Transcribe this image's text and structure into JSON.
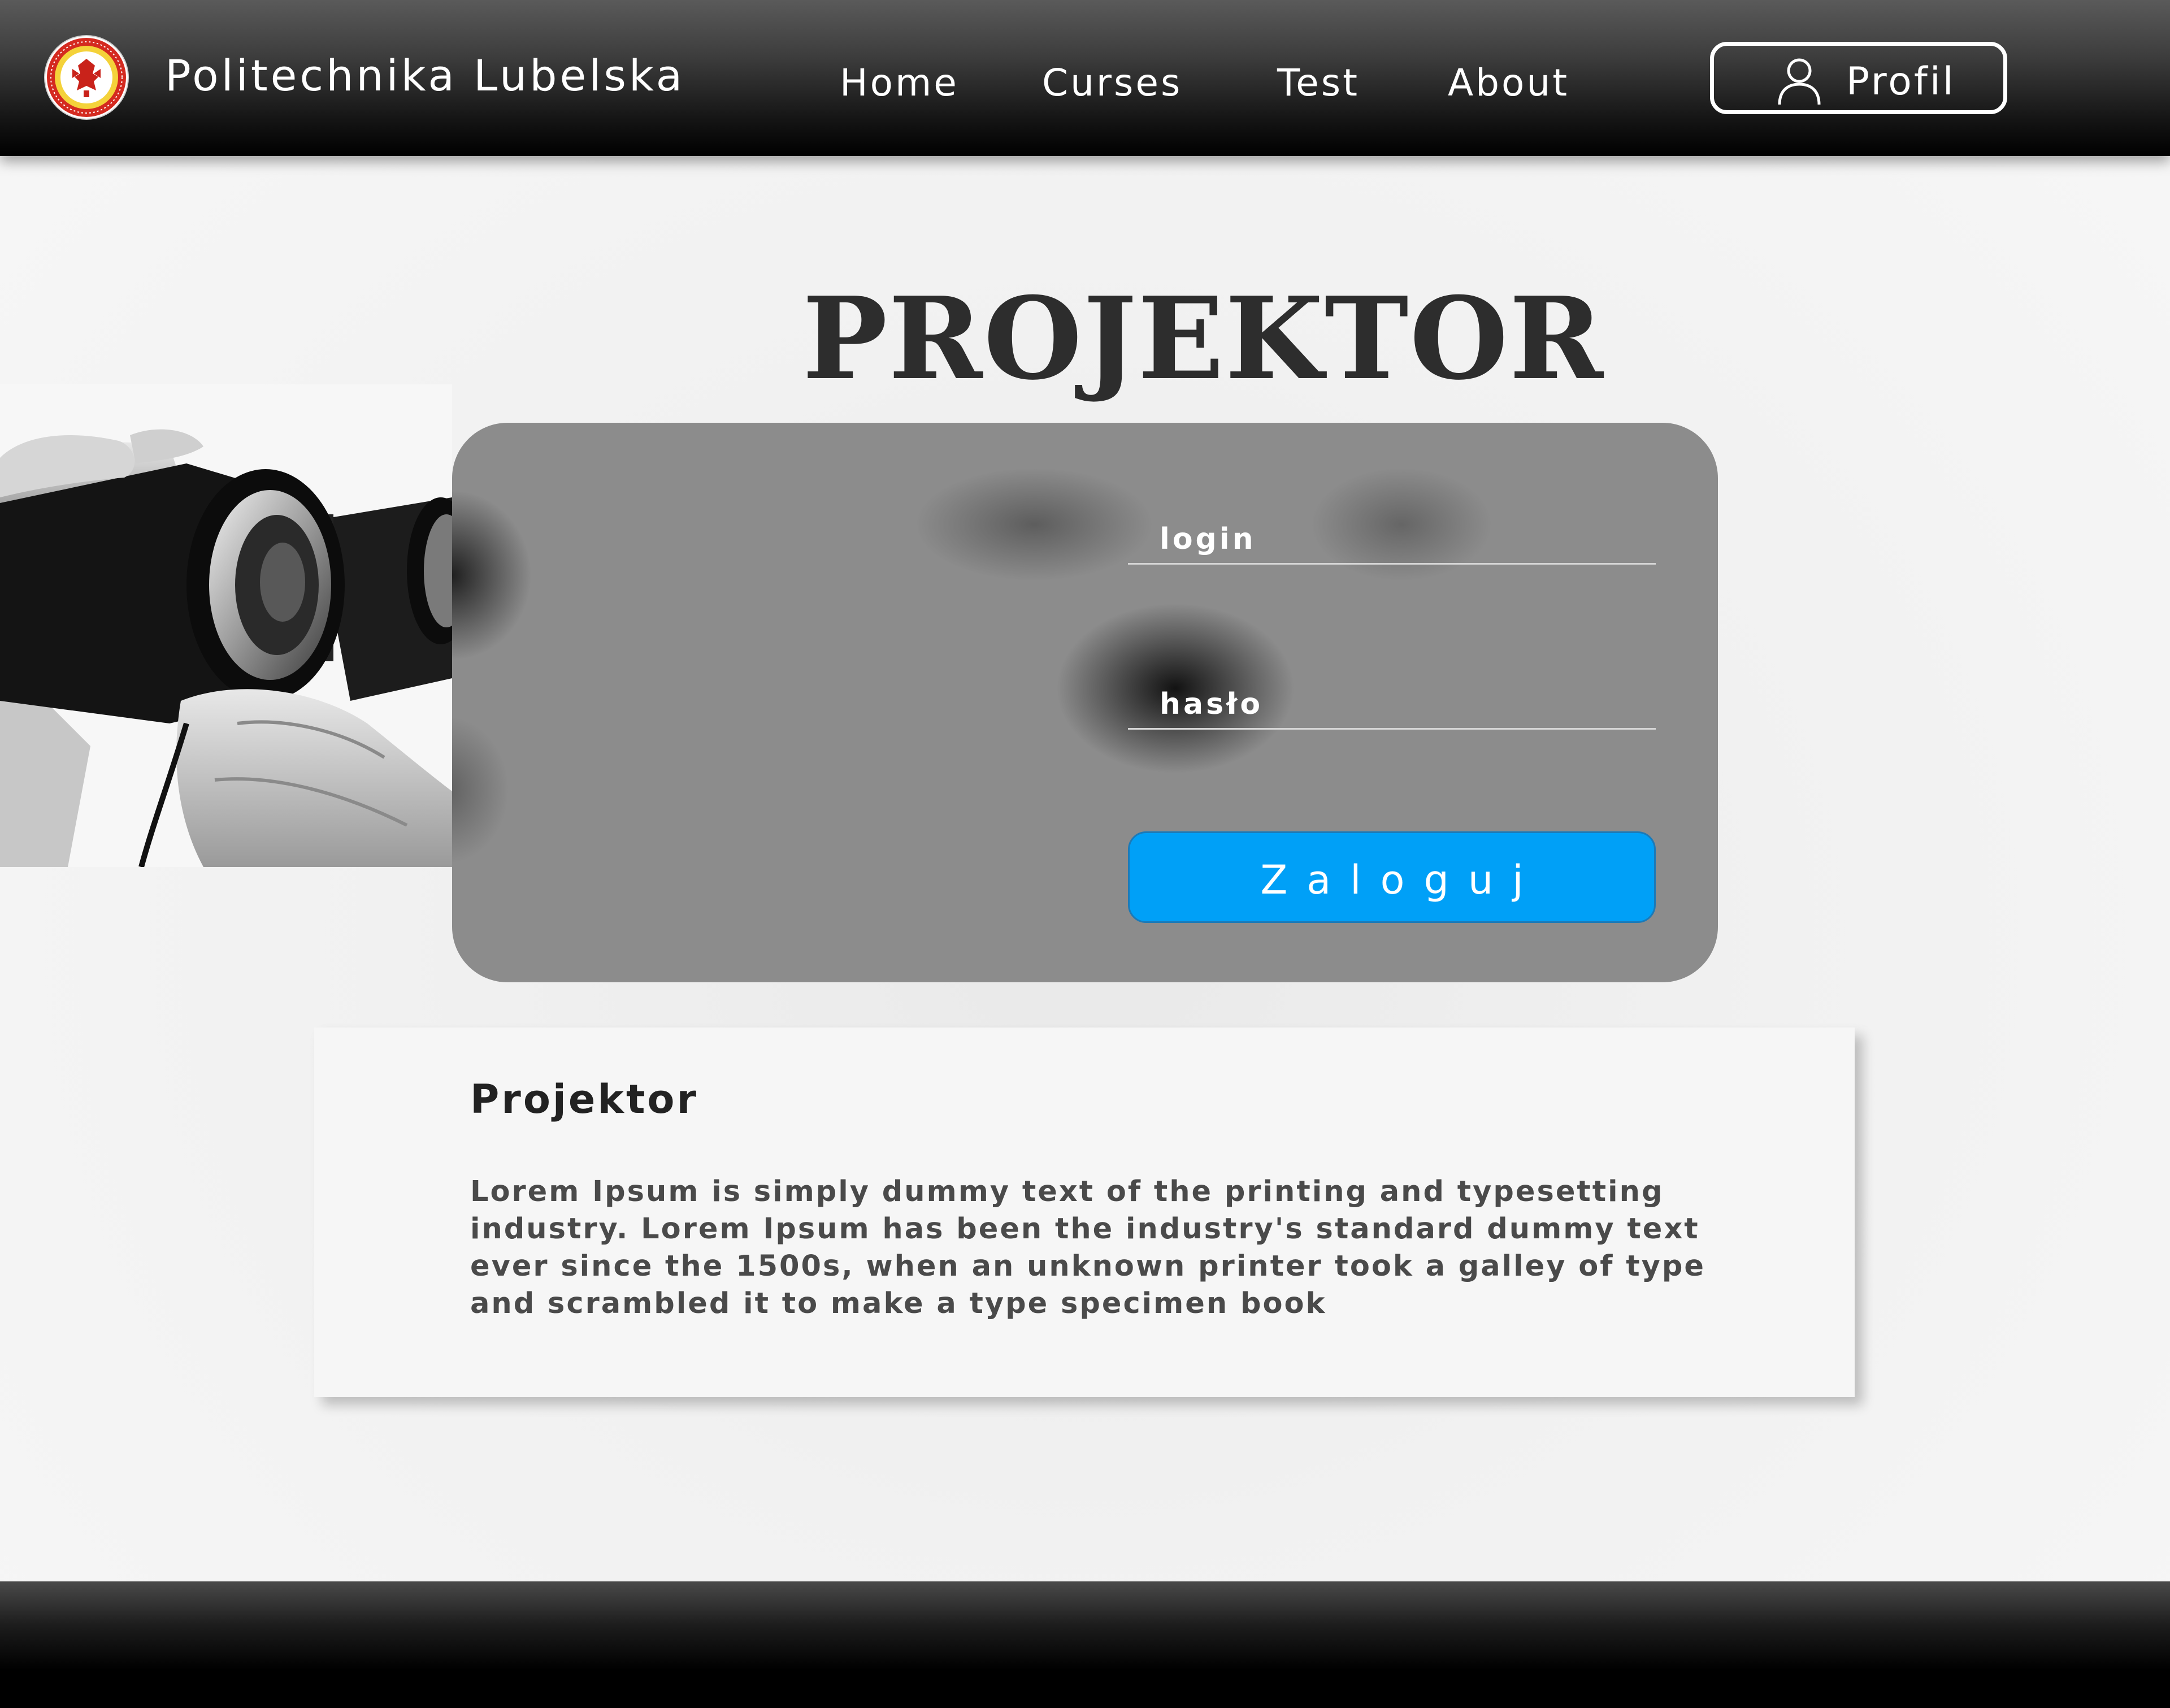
{
  "header": {
    "brand": "Politechnika Lubelska",
    "nav": [
      {
        "label": "Home"
      },
      {
        "label": "Curses"
      },
      {
        "label": "Test"
      },
      {
        "label": "About"
      }
    ],
    "profile_label": "Profil",
    "logo_icon": "university-seal-icon",
    "profile_icon": "user-icon"
  },
  "hero": {
    "title": "PROJEKTOR",
    "image": "binoculars-photo"
  },
  "login": {
    "login_placeholder": "login",
    "password_placeholder": "hasło",
    "submit_label": "Zaloguj",
    "accent_color": "#00a0f7"
  },
  "info": {
    "title": "Projektor",
    "text": "Lorem Ipsum is simply dummy text of the printing and typesetting industry. Lorem Ipsum has been the industry's standard dummy text ever since the 1500s, when an unknown printer took a galley of type and scrambled it to make a type specimen book"
  }
}
